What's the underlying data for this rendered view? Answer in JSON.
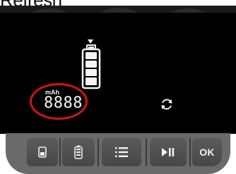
{
  "page": {
    "heading": "Refresh"
  },
  "display": {
    "unit_label": "mAh",
    "readout": "8888"
  },
  "battery": {
    "charge_level": 1.0,
    "segments": 4
  },
  "icons": {
    "slot_indicator": "down-triangle-icon",
    "battery": "battery-icon",
    "refresh": "refresh-cycle-icon"
  },
  "keypad": {
    "keys": [
      {
        "icon": "single-cell-icon"
      },
      {
        "icon": "battery-cell-icon"
      },
      {
        "icon": "menu-list-icon"
      },
      {
        "icon": "play-pause-icon"
      },
      {
        "label": "OK"
      }
    ]
  },
  "colors": {
    "screen": "#000000",
    "highlight": "#d81111",
    "keypad": "#6a6a6a"
  }
}
